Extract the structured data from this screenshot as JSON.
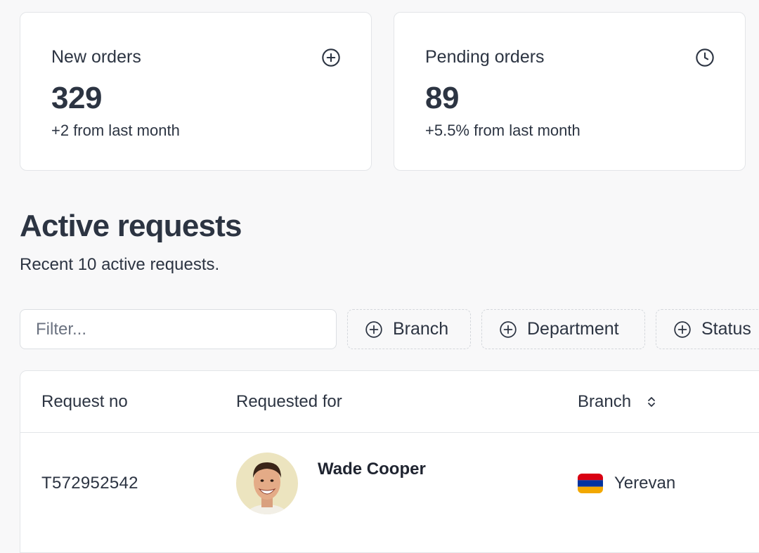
{
  "stats": [
    {
      "title": "New orders",
      "value": "329",
      "change": "+2 from last month",
      "icon": "plus-circle-icon"
    },
    {
      "title": "Pending orders",
      "value": "89",
      "change": "+5.5% from last month",
      "icon": "clock-icon"
    }
  ],
  "section": {
    "title": "Active requests",
    "subtitle": "Recent 10 active requests."
  },
  "filters": {
    "placeholder": "Filter...",
    "chips": [
      "Branch",
      "Department",
      "Status"
    ]
  },
  "table": {
    "columns": [
      "Request no",
      "Requested for",
      "Branch"
    ],
    "rows": [
      {
        "request_no": "T572952542",
        "requested_for": "Wade Cooper",
        "branch": "Yerevan"
      }
    ]
  },
  "colors": {
    "text": "#2c3442",
    "background": "#f8f8f9",
    "card": "#ffffff",
    "border": "#e3e5e8",
    "flag_red": "#d90012",
    "flag_blue": "#0033a0",
    "flag_orange": "#f2a800"
  }
}
